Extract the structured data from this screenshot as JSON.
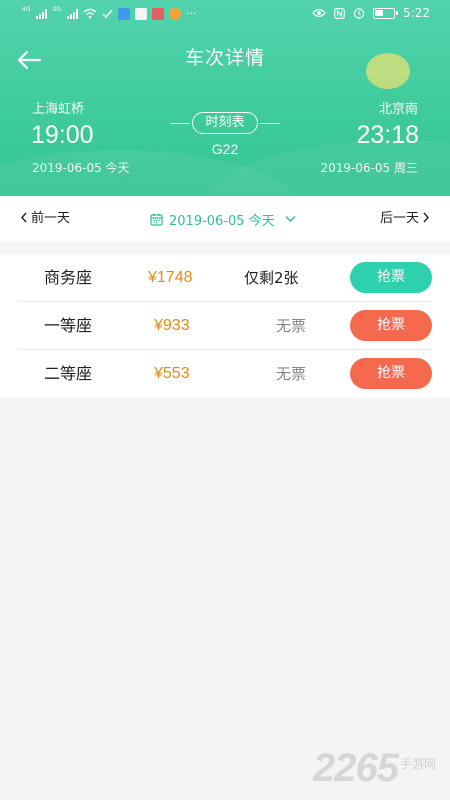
{
  "colors": {
    "header_green": "#3ecb9b",
    "accent_teal": "#2fbf97",
    "price_orange": "#e38d10",
    "grab_green": "#2ed1ae",
    "grab_red": "#f56a4f"
  },
  "status_bar": {
    "time": "5:22",
    "left_icons": [
      "signal-4g-icon",
      "signal-2g-icon",
      "wifi-icon",
      "check-icon",
      "app-icon",
      "book-icon",
      "camera-icon",
      "app-icon",
      "more-icon"
    ],
    "right_icons": [
      "eye-icon",
      "nfc-icon",
      "alarm-icon",
      "battery-icon"
    ],
    "more": "···",
    "sig1_tag": "4G",
    "sig2_tag": "2G"
  },
  "header": {
    "title": "车次详情",
    "back_icon": "arrow-left-icon"
  },
  "trip": {
    "from_station": "上海虹桥",
    "to_station": "北京南",
    "depart_time": "19:00",
    "arrive_time": "23:18",
    "depart_date": "2019-06-05 今天",
    "arrive_date": "2019-06-05 周三",
    "train_number": "G22",
    "timetable_label": "时刻表"
  },
  "date_nav": {
    "prev_label": "前一天",
    "next_label": "后一天",
    "current_date": "2019-06-05 今天",
    "calendar_icon": "calendar-icon"
  },
  "seats": [
    {
      "name": "商务座",
      "price": "¥1748",
      "availability": "仅剩2张",
      "button": "抢票",
      "button_color": "#2ed1ae",
      "sold_out": false
    },
    {
      "name": "一等座",
      "price": "¥933",
      "availability": "无票",
      "button": "抢票",
      "button_color": "#f56a4f",
      "sold_out": true
    },
    {
      "name": "二等座",
      "price": "¥553",
      "availability": "无票",
      "button": "抢票",
      "button_color": "#f56a4f",
      "sold_out": true
    }
  ],
  "watermark": {
    "number": "2265",
    "text": "手游网"
  }
}
